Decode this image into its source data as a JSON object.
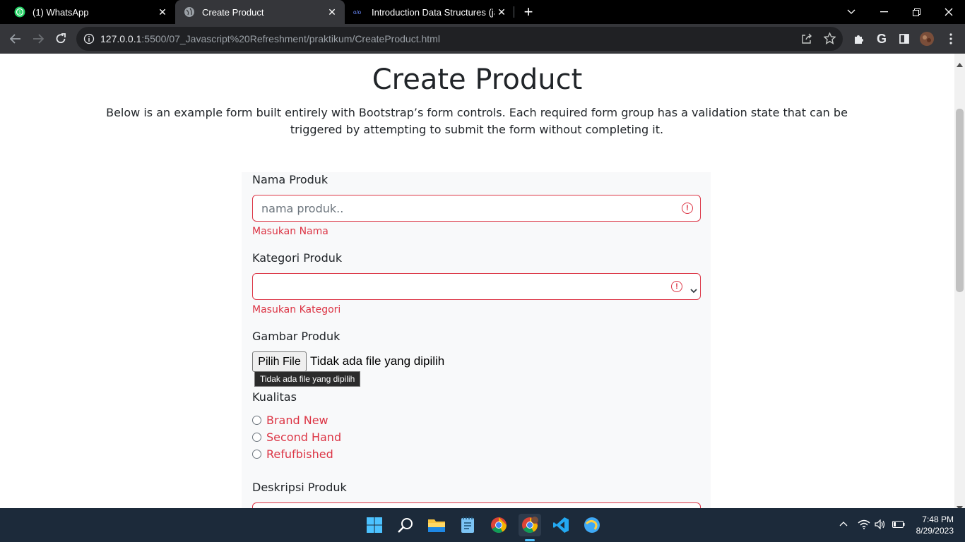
{
  "browser": {
    "tabs": [
      {
        "title": "(1) WhatsApp",
        "icon": "whatsapp-icon",
        "active": false
      },
      {
        "title": "Create Product",
        "icon": "globe-icon",
        "active": true
      },
      {
        "title": "Introduction Data Structures (java",
        "icon": "site-icon",
        "active": false
      }
    ],
    "url_host": "127.0.0.1",
    "url_path": ":5500/07_Javascript%20Refreshment/praktikum/CreateProduct.html"
  },
  "page": {
    "title": "Create Product",
    "lead": "Below is an example form built entirely with Bootstrap’s form controls. Each required form group has a validation state that can be triggered by attempting to submit the form without completing it.",
    "form": {
      "name_label": "Nama Produk",
      "name_placeholder": "nama produk..",
      "name_feedback": "Masukan Nama",
      "category_label": "Kategori Produk",
      "category_feedback": "Masukan Kategori",
      "image_label": "Gambar Produk",
      "file_button": "Pilih File",
      "file_status": "Tidak ada file yang dipilih",
      "file_tooltip": "Tidak ada file yang dipilih",
      "quality_label": "Kualitas",
      "quality_options": [
        "Brand New",
        "Second Hand",
        "Refufbished"
      ],
      "description_label": "Deskripsi Produk"
    }
  },
  "taskbar": {
    "time": "7:48 PM",
    "date": "8/29/2023"
  },
  "colors": {
    "danger": "#dc3545",
    "tab_bar": "#000000",
    "toolbar": "#35363a"
  }
}
